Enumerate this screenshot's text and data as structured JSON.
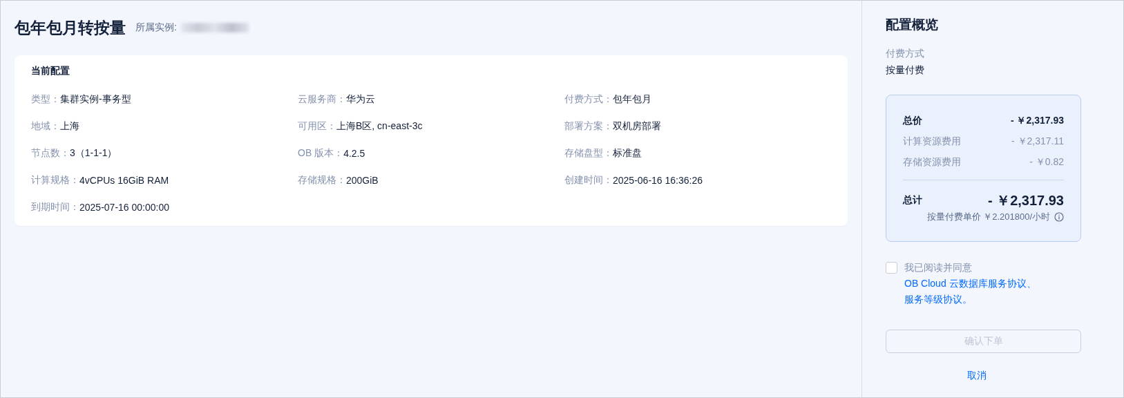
{
  "page": {
    "title": "包年包月转按量",
    "instance_label": "所属实例:"
  },
  "current_config": {
    "title": "当前配置",
    "fields": [
      {
        "label": "类型：",
        "value": "集群实例-事务型"
      },
      {
        "label": "云服务商：",
        "value": "华为云"
      },
      {
        "label": "付费方式：",
        "value": "包年包月"
      },
      {
        "label": "地域：",
        "value": "上海"
      },
      {
        "label": "可用区：",
        "value": "上海B区, cn-east-3c"
      },
      {
        "label": "部署方案：",
        "value": "双机房部署"
      },
      {
        "label": "节点数：",
        "value": "3（1-1-1）"
      },
      {
        "label": "OB 版本：",
        "value": "4.2.5"
      },
      {
        "label": "存储盘型：",
        "value": "标准盘"
      },
      {
        "label": "计算规格：",
        "value": "4vCPUs 16GiB RAM"
      },
      {
        "label": "存储规格：",
        "value": "200GiB"
      },
      {
        "label": "创建时间：",
        "value": "2025-06-16 16:36:26"
      },
      {
        "label": "到期时间：",
        "value": "2025-07-16 00:00:00"
      }
    ]
  },
  "summary": {
    "title": "配置概览",
    "billing_label": "付费方式",
    "billing_value": "按量付费",
    "price": {
      "total_label": "总价",
      "total_value": "- ￥2,317.93",
      "items": [
        {
          "label": "计算资源费用",
          "value": "- ￥2,317.11"
        },
        {
          "label": "存储资源费用",
          "value": "- ￥0.82"
        }
      ],
      "grand_label": "总计",
      "grand_value": "- ￥2,317.93",
      "unit_price": "按量付费单价 ￥2.201800/小时"
    },
    "agreement": {
      "checked": false,
      "prefix": "我已阅读并同意 ",
      "links": [
        "OB Cloud 云数据库服务协议",
        "服务等级协议"
      ],
      "separator": "、",
      "suffix": "。"
    },
    "confirm_button": {
      "label": "确认下单",
      "disabled": true
    },
    "cancel_link": "取消"
  }
}
